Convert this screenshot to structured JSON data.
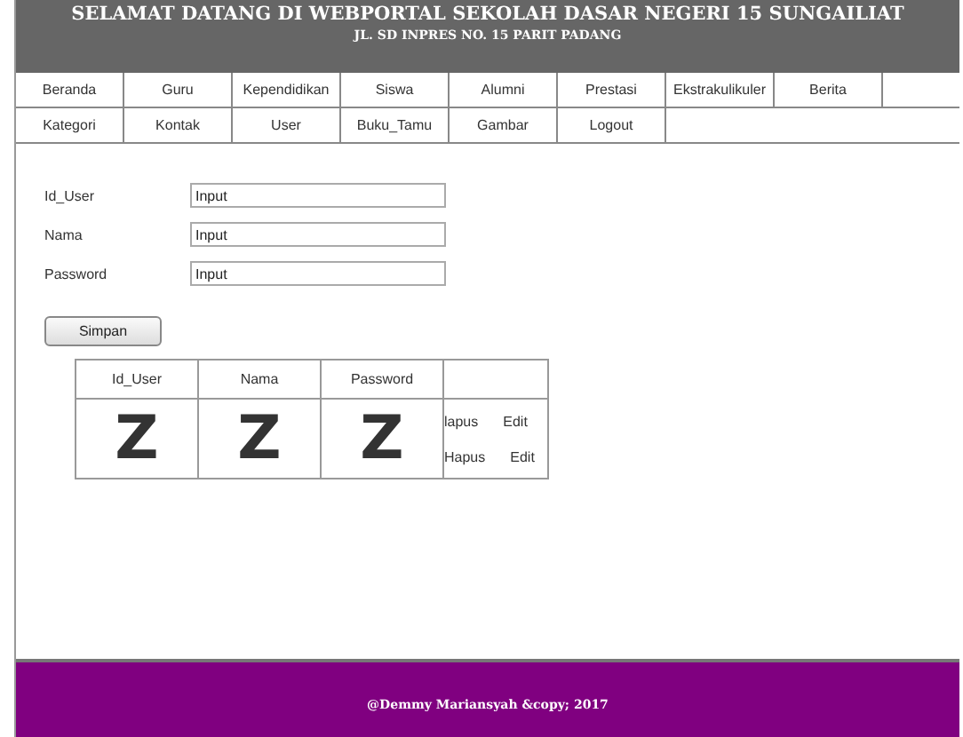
{
  "header": {
    "title": "SELAMAT DATANG DI WEBPORTAL SEKOLAH DASAR NEGERI 15 SUNGAILIAT",
    "subtitle": "JL. SD INPRES NO. 15 PARIT PADANG"
  },
  "menu_rows": [
    [
      "Beranda",
      "Guru",
      "Kependidikan",
      "Siswa",
      "Alumni",
      "Prestasi",
      "Ekstrakulikuler",
      "Berita",
      ""
    ],
    [
      "Kategori",
      "Kontak",
      "User",
      "Buku_Tamu",
      "Gambar",
      "Logout"
    ]
  ],
  "form": {
    "fields": [
      {
        "label": "Id_User",
        "value": "Input"
      },
      {
        "label": "Nama",
        "value": "Input"
      },
      {
        "label": "Password",
        "value": "Input"
      }
    ],
    "button": "Simpan"
  },
  "table": {
    "columns": [
      "Id_User",
      "Nama",
      "Password",
      ""
    ],
    "rows": [
      {
        "cells": [
          "Z",
          "Z",
          "Z"
        ],
        "actions": [
          [
            "lapus",
            "Edit"
          ],
          [
            "Hapus",
            "Edit"
          ]
        ]
      }
    ]
  },
  "footer": "@Demmy Mariansyah &copy; 2017"
}
